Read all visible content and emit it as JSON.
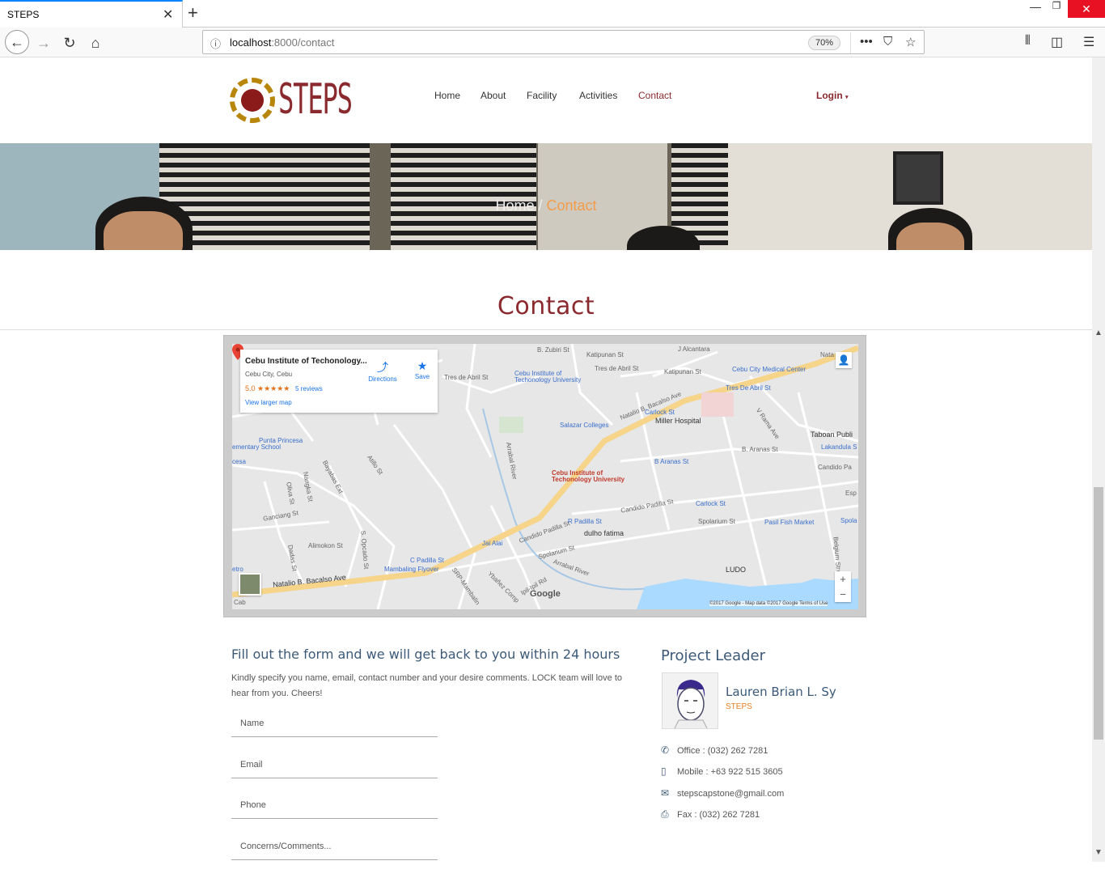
{
  "browser": {
    "tab_title": "STEPS",
    "tab_close": "✕",
    "new_tab": "+",
    "url_host": "localhost",
    "url_rest": ":8000/contact",
    "zoom": "70%"
  },
  "site": {
    "logo_text": "STEPS",
    "menu": [
      "Home",
      "About",
      "Facility",
      "Activities",
      "Contact"
    ],
    "active_menu": "Contact",
    "login_label": "Login",
    "login_caret": "▾"
  },
  "hero": {
    "crumb_home": "Home",
    "crumb_sep": " / ",
    "crumb_current": "Contact"
  },
  "page_title": "Contact",
  "map": {
    "place_name": "Cebu Institute of Techonology...",
    "place_city": "Cebu City, Cebu",
    "rating": "5.0 ★★★★★",
    "reviews": "5 reviews",
    "larger_map": "View larger map",
    "directions": "Directions",
    "save": "Save",
    "pin_label_1": "Cebu Institute of",
    "pin_label_2": "Techonology University",
    "google": "Google",
    "footer": "©2017 Google - Map data ©2017 Google     Terms of Use",
    "zoom_in": "+",
    "zoom_out": "−",
    "labels": {
      "zubiri": "B. Zubiri St",
      "katipunan1": "Katipunan St",
      "jalcantara": "J Alcantara",
      "natal": "Nata",
      "tres_de_abril1": "Tres de Abril St",
      "cit_small_1": "Cebu Institute of",
      "cit_small_2": "Techonology University",
      "tres_de_abril2": "Tres de Abril St",
      "katipunan2": "Katipunan St",
      "medcenter": "Cebu City Medical Center",
      "tres_de_abril3": "Tres De Abril St",
      "bacalso_top": "Natalio B. Bacalso Ave",
      "carlock1": "Carlock St",
      "miller": "Miller Hospital",
      "salazar": "Salazar Colleges",
      "vrama": "V Rama Ave",
      "taboan": "Taboan Publi",
      "punta1": "Punta Princesa",
      "punta2": "ementary School",
      "arrabal1": "Arrabal River",
      "baranas1": "B Aranas St",
      "baranas2": "B. Aranas St",
      "lakandula": "Lakandula S",
      "candido1": "Candido Pa",
      "esp": "Esp",
      "cesa": "cesa",
      "atillo": "Atillo St",
      "bayabas": "Bayabas Ext",
      "nangka": "Nangka St",
      "olivia": "Oliva St",
      "ganciang": "Ganciang St",
      "alimokon": "Alimokon St",
      "dadas": "Dadas St",
      "sopcado": "S. Opcado St",
      "candido2": "Candido Padilla St",
      "carlock2": "Carlock St",
      "spolarium1": "Spolarium St",
      "pasil": "Pasil Fish Market",
      "spola": "Spola",
      "rpadilla": "R Padilla St",
      "jaialai": "Jai Alai",
      "candido3": "Candido Padilla St",
      "dulho": "dulho fatima",
      "spolarium2": "Spolarium St",
      "cpadilla": "C Padilla St",
      "mambaling": "Mambaling Flyover",
      "arrabal2": "Arrabal River",
      "srp": "SRP-Mambalin",
      "ybanez": "Ybañez Comp",
      "ipilipil": "Ipil-Ipil Rd",
      "ludo": "LUDO",
      "belgium": "Belgium Street",
      "bacalso_bottom": "Natalio B. Bacalso Ave",
      "etro": "etro",
      "cab": "Cab"
    }
  },
  "form": {
    "title": "Fill out the form and we will get back to you within 24 hours",
    "description": "Kindly specify you name, email, contact number and your desire comments. LOCK team will love to hear from you. Cheers!",
    "name_placeholder": "Name",
    "email_placeholder": "Email",
    "phone_placeholder": "Phone",
    "comments_placeholder": "Concerns/Comments..."
  },
  "leader": {
    "section_title": "Project Leader",
    "name": "Lauren Brian L. Sy",
    "org": "STEPS",
    "office": "Office : (032) 262 7281",
    "mobile": "Mobile : +63 922 515 3605",
    "email": "stepscapstone@gmail.com",
    "fax": "Fax : (032) 262 7281"
  },
  "colors": {
    "brand": "#8b2a2e",
    "accent": "#e67e22",
    "heading": "#3c5a78"
  }
}
